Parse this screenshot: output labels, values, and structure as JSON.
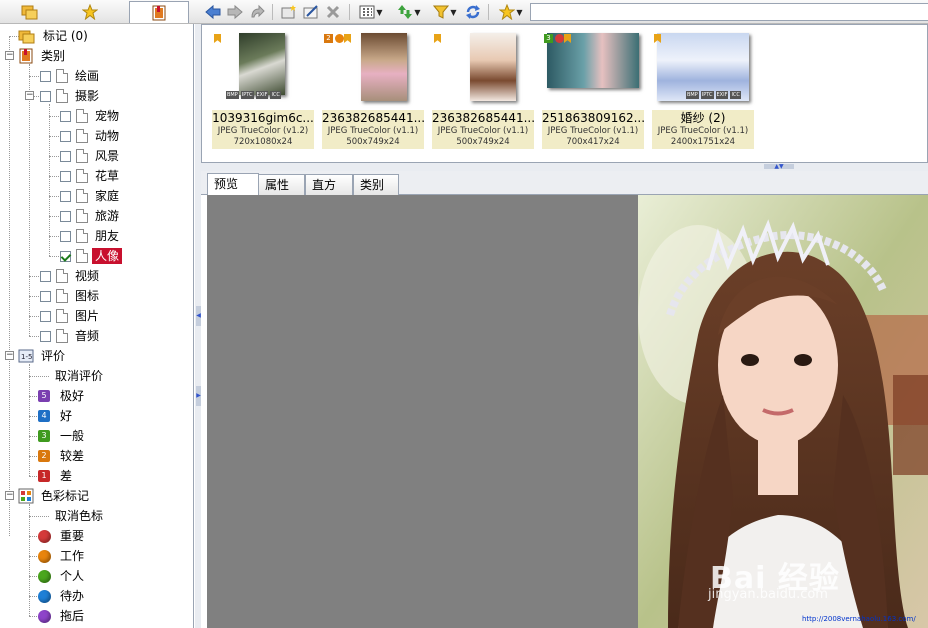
{
  "left_tabs": [
    {
      "name": "folders",
      "icon": "folders-icon"
    },
    {
      "name": "favorites",
      "icon": "star-icon"
    },
    {
      "name": "catalog",
      "icon": "catalog-icon"
    }
  ],
  "toolbar": {
    "icons": [
      "back-arrow-icon",
      "forward-arrow-icon",
      "up-folder-icon",
      "new-folder-icon",
      "rename-icon",
      "delete-icon",
      "view-mode-icon",
      "sort-icon",
      "filter-icon",
      "refresh-icon",
      "favorites-star-icon"
    ]
  },
  "tree": {
    "tagged": "标记 (0)",
    "category": "类别",
    "cat_items": {
      "painting": "绘画",
      "photo": "摄影",
      "pet": "宠物",
      "animal": "动物",
      "scenery": "风景",
      "flower": "花草",
      "family": "家庭",
      "travel": "旅游",
      "friends": "朋友",
      "portrait": "人像",
      "video": "视频",
      "icons": "图标",
      "pictures": "图片",
      "audio": "音频"
    },
    "rating": "评价",
    "ratings": [
      {
        "label": "取消评价",
        "badge": "",
        "color": ""
      },
      {
        "label": "极好",
        "badge": "5",
        "color": "#7a3fb0"
      },
      {
        "label": "好",
        "badge": "4",
        "color": "#1f6fc5"
      },
      {
        "label": "一般",
        "badge": "3",
        "color": "#3f9a1f"
      },
      {
        "label": "较差",
        "badge": "2",
        "color": "#d9780e"
      },
      {
        "label": "差",
        "badge": "1",
        "color": "#c62828"
      }
    ],
    "color_label": "色彩标记",
    "colors": [
      {
        "label": "取消色标",
        "color": ""
      },
      {
        "label": "重要",
        "color": "#d43a3a"
      },
      {
        "label": "工作",
        "color": "#e8840c"
      },
      {
        "label": "个人",
        "color": "#4aa61d"
      },
      {
        "label": "待办",
        "color": "#1e7fd6"
      },
      {
        "label": "拖后",
        "color": "#8e44c9"
      }
    ]
  },
  "thumbnails": [
    {
      "name": "1039316gim6c...",
      "format": "JPEG TrueColor (v1.2)",
      "size": "720x1080x24"
    },
    {
      "name": "236382685441...",
      "format": "JPEG TrueColor (v1.1)",
      "size": "500x749x24"
    },
    {
      "name": "236382685441...",
      "format": "JPEG TrueColor (v1.1)",
      "size": "500x749x24"
    },
    {
      "name": "251863809162...",
      "format": "JPEG TrueColor (v1.1)",
      "size": "700x417x24"
    },
    {
      "name": "婚纱 (2)",
      "format": "JPEG TrueColor (v1.1)",
      "size": "2400x1751x24"
    }
  ],
  "badges": {
    "bmp": "BMP",
    "iptc": "IPTC",
    "exif": "EXIF",
    "icc": "ICC"
  },
  "preview_tabs": [
    "预览",
    "属性",
    "直方图",
    "类别"
  ],
  "watermark": {
    "brand": "Bai 经验",
    "url": "jingyan.baidu.com",
    "small": "http://2008vernahaolu.163.com/"
  }
}
